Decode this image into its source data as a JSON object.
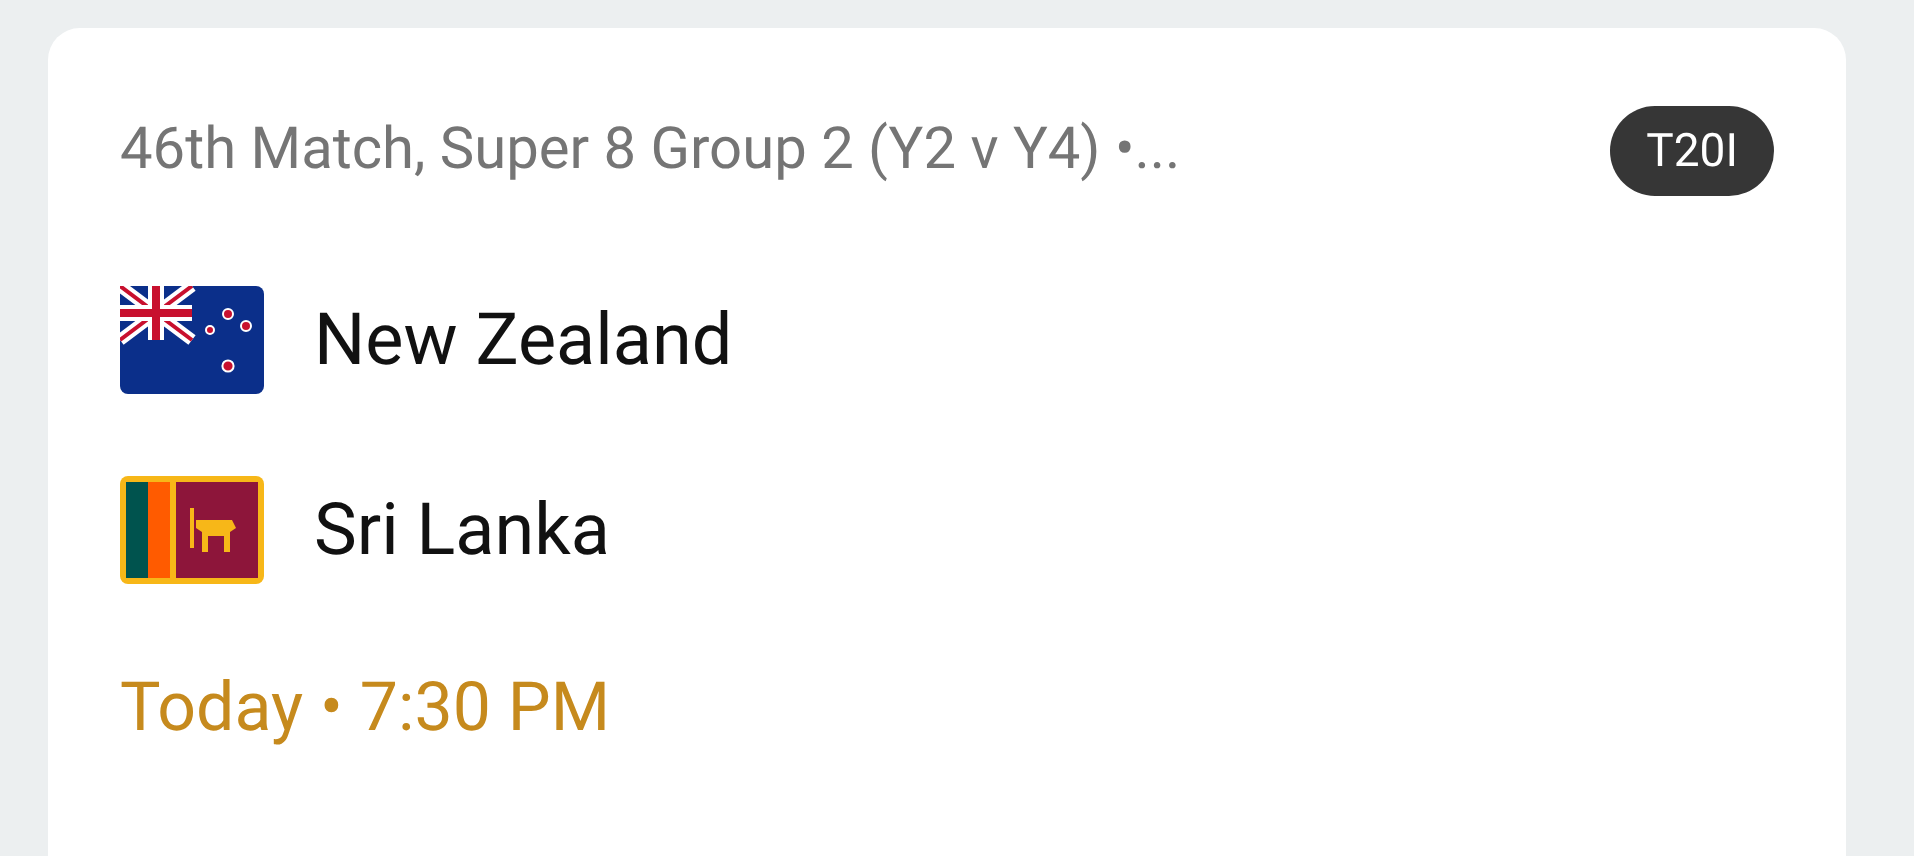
{
  "match": {
    "title": "46th Match, Super 8 Group 2 (Y2 v Y4) •...",
    "format": "T20I"
  },
  "teams": [
    {
      "name": "New Zealand",
      "kind": "newzealand"
    },
    {
      "name": "Sri Lanka",
      "kind": "srilanka"
    }
  ],
  "time": "Today • 7:30 PM"
}
